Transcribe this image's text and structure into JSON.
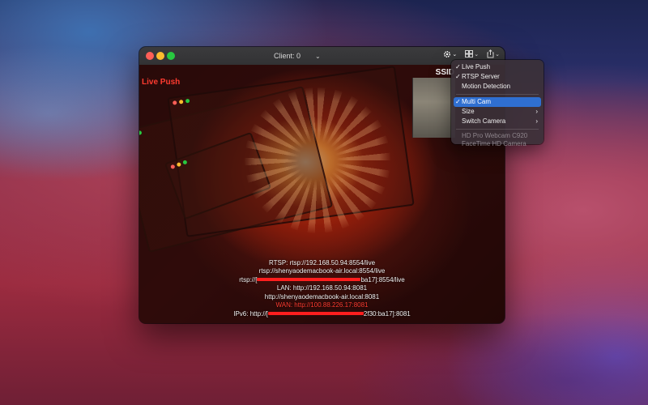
{
  "window": {
    "client_selector": "Client: 0",
    "toolbar": {
      "settings_icon": "gear-icon",
      "layout_icon": "grid-icon",
      "share_icon": "share-icon"
    }
  },
  "video": {
    "live_push_label": "Live Push",
    "ssid_label": "SSID",
    "overlay_lines": {
      "rtsp_ip": "RTSP: rtsp://192.168.50.94:8554/live",
      "rtsp_host": "rtsp://shenyaodemacbook-air.local:8554/live",
      "rtsp_v6_prefix": "rtsp://[",
      "rtsp_v6_suffix": "ba17]:8554/live",
      "lan_ip": "LAN: http://192.168.50.94:8081",
      "lan_host": "http://shenyaodemacbook-air.local:8081",
      "wan": "WAN: http://100.88.226.17:8081",
      "ipv6_prefix": "IPv6: http://[",
      "ipv6_suffix": "2f30:ba17]:8081"
    }
  },
  "menu": {
    "items": [
      {
        "label": "Live Push",
        "checked": true
      },
      {
        "label": "RTSP Server",
        "checked": true
      },
      {
        "label": "Motion Detection",
        "checked": false
      },
      {
        "label": "Multi Cam",
        "checked": true,
        "selected": true
      },
      {
        "label": "Size",
        "submenu": true
      },
      {
        "label": "Switch Camera",
        "submenu": true
      },
      {
        "label": "HD Pro Webcam C920",
        "disabled": true
      },
      {
        "label": "FaceTime HD Camera",
        "disabled": true
      }
    ],
    "check_glyph": "✓",
    "submenu_glyph": "›"
  },
  "colors": {
    "live_push": "#ff3b30",
    "menu_highlight": "#2f6fd1",
    "redaction": "#ff1e1e"
  }
}
